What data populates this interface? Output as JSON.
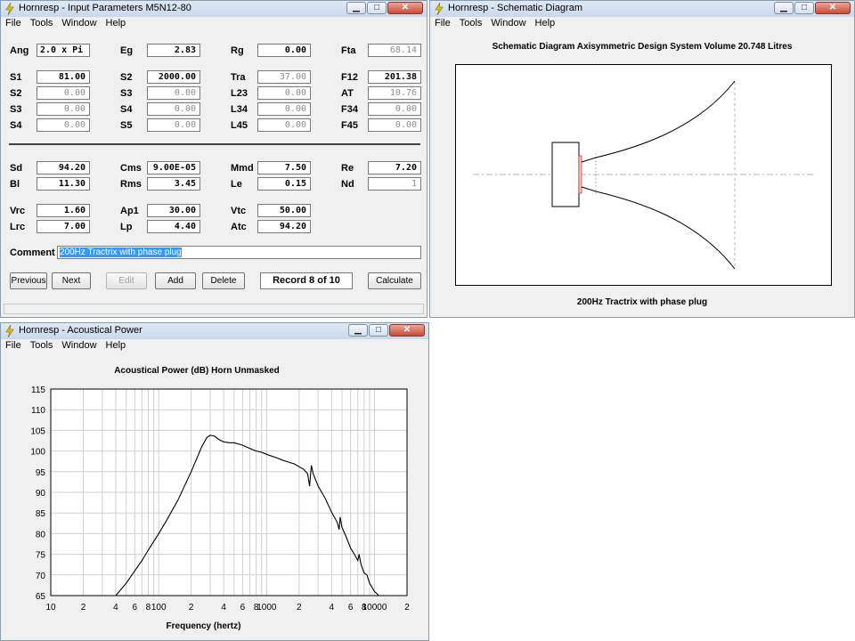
{
  "input_window": {
    "title": "Hornresp - Input Parameters   M5N12-80",
    "menu": [
      "File",
      "Tools",
      "Window",
      "Help"
    ],
    "fields": [
      {
        "label": "Ang",
        "value": "2.0 x Pi",
        "dim": false
      },
      {
        "label": "Eg",
        "value": "2.83",
        "dim": false
      },
      {
        "label": "Rg",
        "value": "0.00",
        "dim": false
      },
      {
        "label": "Fta",
        "value": "68.14",
        "dim": true
      },
      {
        "label": "S1",
        "value": "81.00",
        "dim": false
      },
      {
        "label": "S2",
        "value": "2000.00",
        "dim": false
      },
      {
        "label": "Tra",
        "value": "37.00",
        "dim": true
      },
      {
        "label": "F12",
        "value": "201.38",
        "dim": false
      },
      {
        "label": "S2",
        "value": "0.00",
        "dim": true
      },
      {
        "label": "S3",
        "value": "0.00",
        "dim": true
      },
      {
        "label": "L23",
        "value": "0.00",
        "dim": true
      },
      {
        "label": "AT",
        "value": "10.76",
        "dim": true
      },
      {
        "label": "S3",
        "value": "0.00",
        "dim": true
      },
      {
        "label": "S4",
        "value": "0.00",
        "dim": true
      },
      {
        "label": "L34",
        "value": "0.00",
        "dim": true
      },
      {
        "label": "F34",
        "value": "0.00",
        "dim": true
      },
      {
        "label": "S4",
        "value": "0.00",
        "dim": true
      },
      {
        "label": "S5",
        "value": "0.00",
        "dim": true
      },
      {
        "label": "L45",
        "value": "0.00",
        "dim": true
      },
      {
        "label": "F45",
        "value": "0.00",
        "dim": true
      },
      {
        "label": "Sd",
        "value": "94.20",
        "dim": false
      },
      {
        "label": "Cms",
        "value": "9.00E-05",
        "dim": false
      },
      {
        "label": "Mmd",
        "value": "7.50",
        "dim": false
      },
      {
        "label": "Re",
        "value": "7.20",
        "dim": false
      },
      {
        "label": "Bl",
        "value": "11.30",
        "dim": false
      },
      {
        "label": "Rms",
        "value": "3.45",
        "dim": false
      },
      {
        "label": "Le",
        "value": "0.15",
        "dim": false
      },
      {
        "label": "Nd",
        "value": "1",
        "dim": true
      },
      {
        "label": "Vrc",
        "value": "1.60",
        "dim": false
      },
      {
        "label": "Ap1",
        "value": "30.00",
        "dim": false
      },
      {
        "label": "Vtc",
        "value": "50.00",
        "dim": false
      },
      {
        "label": "Lrc",
        "value": "7.00",
        "dim": false
      },
      {
        "label": "Lp",
        "value": "4.40",
        "dim": false
      },
      {
        "label": "Atc",
        "value": "94.20",
        "dim": false
      }
    ],
    "comment_label": "Comment",
    "comment_value": "200Hz Tractrix  with phase plug",
    "buttons": {
      "previous": "Previous",
      "next": "Next",
      "edit": "Edit",
      "add": "Add",
      "delete": "Delete",
      "record": "Record 8 of 10",
      "calculate": "Calculate"
    }
  },
  "schematic_window": {
    "title": "Hornresp - Schematic Diagram",
    "menu": [
      "File",
      "Tools",
      "Window",
      "Help"
    ],
    "header": "Schematic Diagram   Axisymmetric Design   System Volume 20.748 Litres",
    "caption": "200Hz Tractrix  with phase plug"
  },
  "acoustic_window": {
    "title": "Hornresp - Acoustical Power",
    "menu": [
      "File",
      "Tools",
      "Window",
      "Help"
    ]
  },
  "chart_data": {
    "type": "line",
    "title": "Acoustical Power (dB)   Horn   Unmasked",
    "xlabel": "Frequency (hertz)",
    "ylabel": "",
    "xscale": "log",
    "xlim": [
      10,
      20000
    ],
    "ylim": [
      65,
      115
    ],
    "yticks": [
      65,
      70,
      75,
      80,
      85,
      90,
      95,
      100,
      105,
      110,
      115
    ],
    "xtick_labels": [
      {
        "x": 10,
        "label": "10"
      },
      {
        "x": 20,
        "label": "2"
      },
      {
        "x": 40,
        "label": "4"
      },
      {
        "x": 60,
        "label": "6"
      },
      {
        "x": 80,
        "label": "8"
      },
      {
        "x": 100,
        "label": "100"
      },
      {
        "x": 200,
        "label": "2"
      },
      {
        "x": 400,
        "label": "4"
      },
      {
        "x": 600,
        "label": "6"
      },
      {
        "x": 800,
        "label": "8"
      },
      {
        "x": 1000,
        "label": "1000"
      },
      {
        "x": 2000,
        "label": "2"
      },
      {
        "x": 4000,
        "label": "4"
      },
      {
        "x": 6000,
        "label": "6"
      },
      {
        "x": 8000,
        "label": "8"
      },
      {
        "x": 10000,
        "label": "10000"
      },
      {
        "x": 20000,
        "label": "2"
      }
    ],
    "grid": true,
    "series": [
      {
        "x": [
          40,
          50,
          60,
          70,
          80,
          100,
          120,
          150,
          200,
          250,
          280,
          300,
          330,
          360,
          400,
          450,
          500,
          600,
          700,
          800,
          900,
          1000,
          1200,
          1400,
          1600,
          1800,
          2000,
          2200,
          2400,
          2450,
          2500,
          2550,
          2600,
          2700,
          2800,
          3000,
          3500,
          4000,
          4500,
          4700,
          4800,
          5000,
          5500,
          6000,
          6500,
          7000,
          7200,
          7500,
          8000,
          8500,
          9000,
          10000,
          11000
        ],
        "y": [
          65,
          68,
          71,
          73.5,
          76,
          80,
          83.5,
          88,
          95,
          101,
          103.3,
          103.8,
          103.6,
          102.8,
          102.2,
          102,
          102,
          101.4,
          100.6,
          100,
          99.7,
          99.2,
          98.5,
          97.8,
          97.3,
          96.9,
          96.2,
          95.6,
          94.5,
          93,
          91.5,
          94,
          96.5,
          94.5,
          93.5,
          91.5,
          88.5,
          85.2,
          82.8,
          81,
          84,
          81.5,
          79,
          76.5,
          75,
          73.5,
          75,
          72.5,
          70.5,
          70,
          68,
          66,
          65
        ]
      }
    ]
  }
}
